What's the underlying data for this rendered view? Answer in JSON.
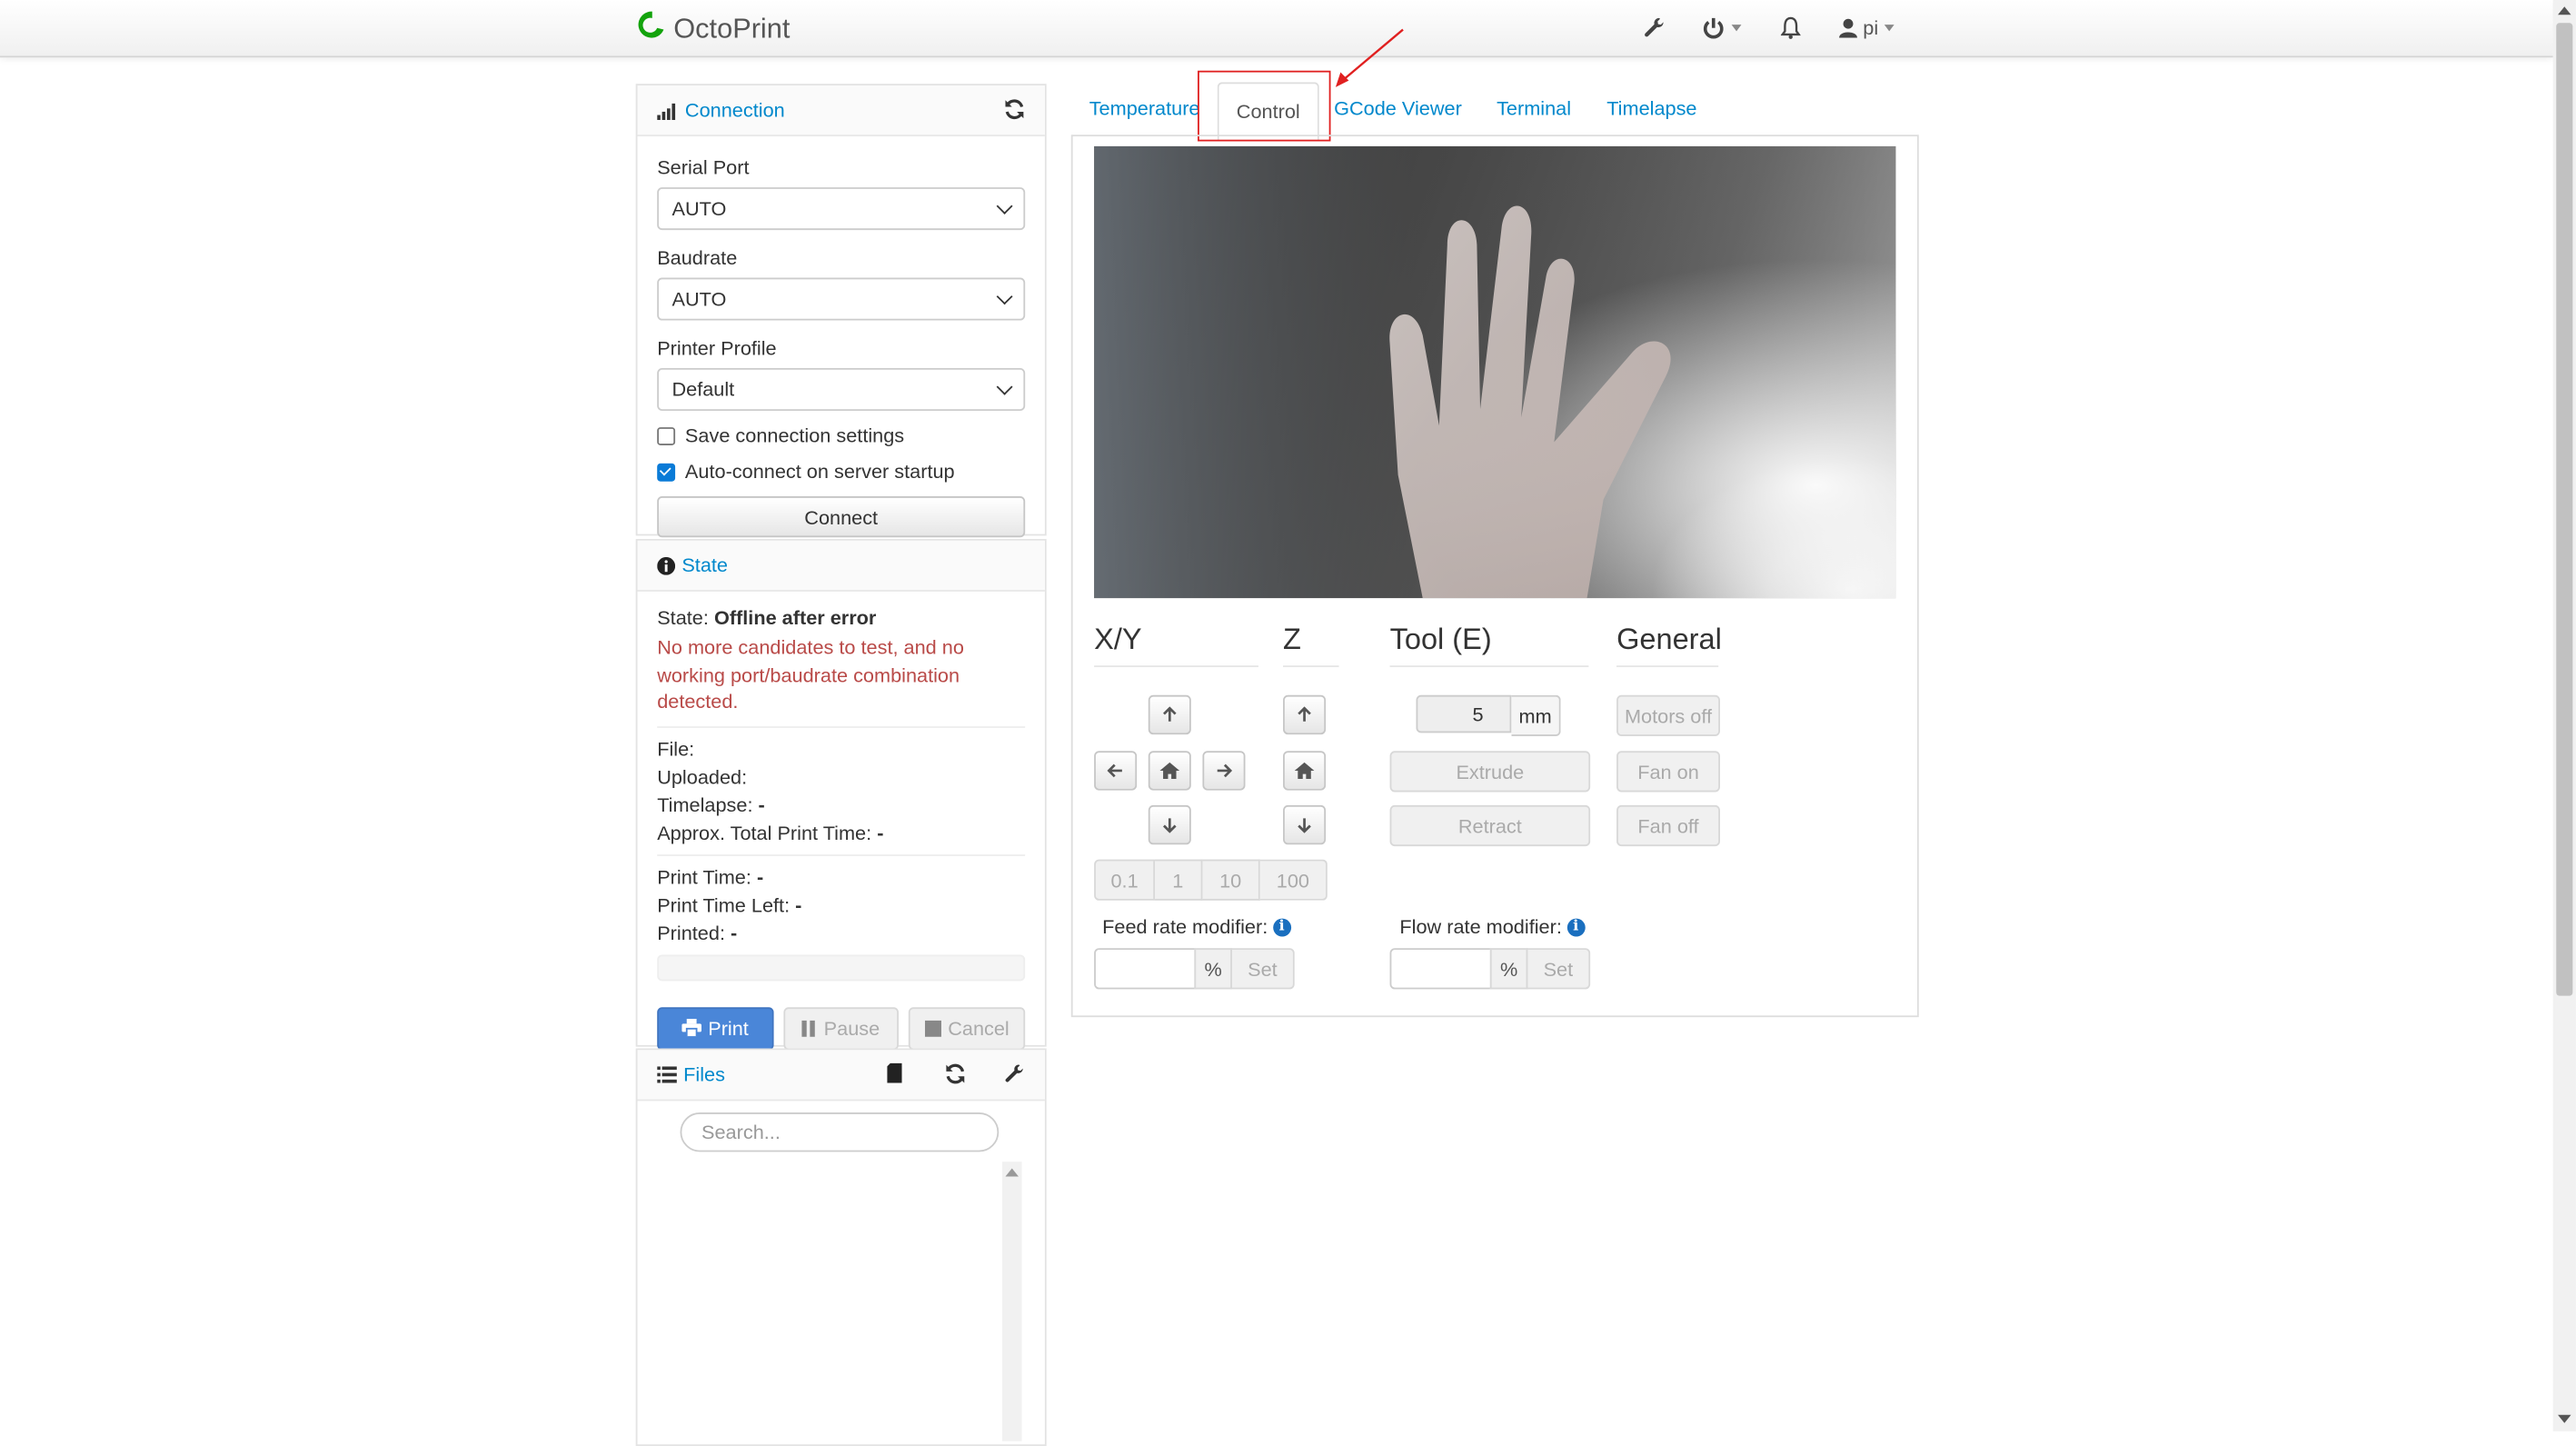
{
  "brand": {
    "name": "OctoPrint"
  },
  "navbar": {
    "user_label": "pi"
  },
  "connection": {
    "title": "Connection",
    "serial_port_label": "Serial Port",
    "serial_port_value": "AUTO",
    "baudrate_label": "Baudrate",
    "baudrate_value": "AUTO",
    "profile_label": "Printer Profile",
    "profile_value": "Default",
    "save_settings_label": "Save connection settings",
    "autoconnect_label": "Auto-connect on server startup",
    "save_settings_checked": false,
    "autoconnect_checked": true,
    "connect_button": "Connect"
  },
  "state": {
    "title": "State",
    "state_prefix": "State:",
    "state_value": "Offline after error",
    "error_message": "No more candidates to test, and no working port/baudrate combination detected.",
    "file_label": "File:",
    "uploaded_label": "Uploaded:",
    "timelapse_label": "Timelapse:",
    "timelapse_value": "-",
    "approx_label": "Approx. Total Print Time:",
    "approx_value": "-",
    "print_time_label": "Print Time:",
    "print_time_value": "-",
    "time_left_label": "Print Time Left:",
    "time_left_value": "-",
    "printed_label": "Printed:",
    "printed_value": "-",
    "print_button": "Print",
    "pause_button": "Pause",
    "cancel_button": "Cancel"
  },
  "files": {
    "title": "Files",
    "search_placeholder": "Search..."
  },
  "tabs": {
    "temperature": "Temperature",
    "control": "Control",
    "gcode": "GCode Viewer",
    "terminal": "Terminal",
    "timelapse": "Timelapse"
  },
  "control": {
    "xy_title": "X/Y",
    "z_title": "Z",
    "tool_title": "Tool (E)",
    "general_title": "General",
    "step_options": [
      "0.1",
      "1",
      "10",
      "100"
    ],
    "extrude_amount": "5",
    "extrude_unit": "mm",
    "extrude_button": "Extrude",
    "retract_button": "Retract",
    "motors_off": "Motors off",
    "fan_on": "Fan on",
    "fan_off": "Fan off",
    "feed_rate_label": "Feed rate modifier:",
    "flow_rate_label": "Flow rate modifier:",
    "percent_unit": "%",
    "set_button": "Set"
  },
  "colors": {
    "link": "#0088cc",
    "error": "#b94a48",
    "primary": "#4a86d8",
    "highlight": "#e02020"
  }
}
